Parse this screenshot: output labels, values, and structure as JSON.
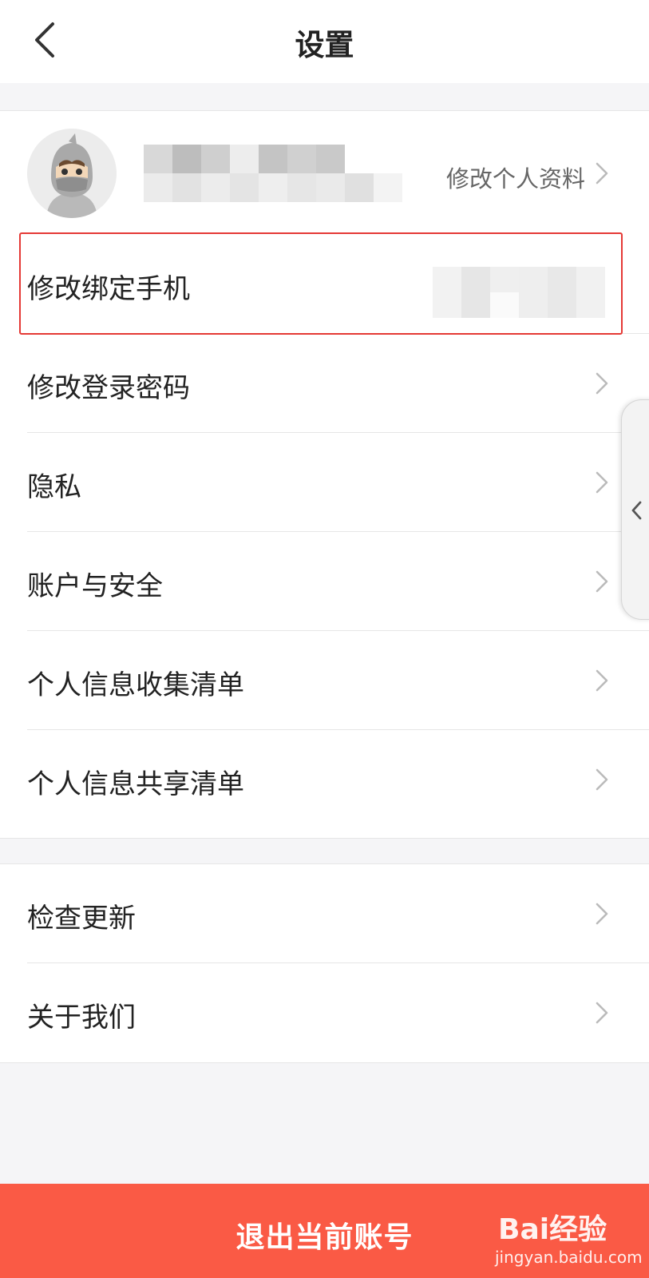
{
  "header": {
    "title": "设置"
  },
  "profile": {
    "edit_label": "修改个人资料"
  },
  "menu_group1": [
    {
      "label": "修改绑定手机"
    },
    {
      "label": "修改登录密码"
    },
    {
      "label": "隐私"
    },
    {
      "label": "账户与安全"
    },
    {
      "label": "个人信息收集清单"
    },
    {
      "label": "个人信息共享清单"
    }
  ],
  "menu_group2": [
    {
      "label": "检查更新"
    },
    {
      "label": "关于我们"
    }
  ],
  "logout": {
    "label": "退出当前账号"
  },
  "watermark": {
    "brand": "Bai经验",
    "url": "jingyan.baidu.com"
  },
  "colors": {
    "accent": "#fa5a45",
    "highlight": "#e53935",
    "background": "#f5f5f7"
  }
}
